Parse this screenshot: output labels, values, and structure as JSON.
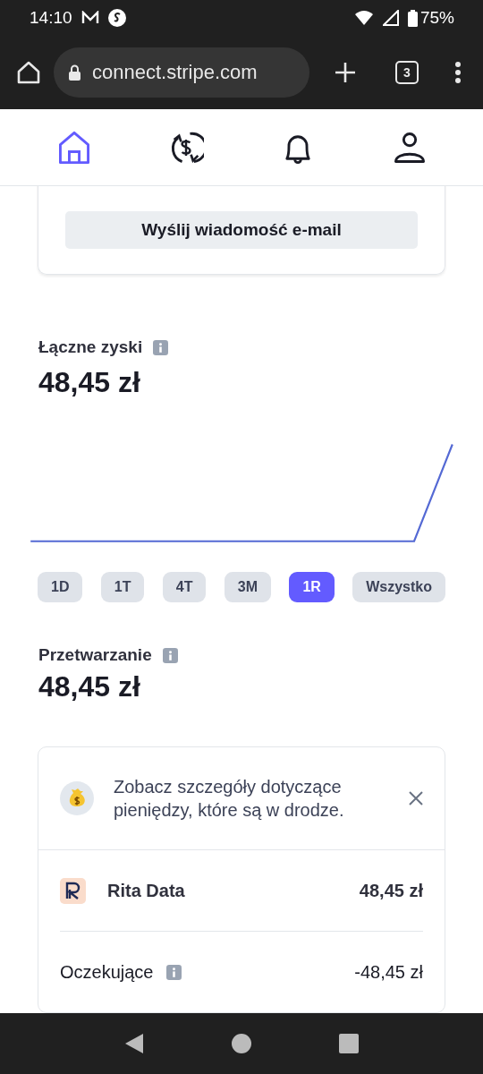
{
  "status_bar": {
    "time": "14:10",
    "battery": "75%"
  },
  "browser": {
    "url": "connect.stripe.com",
    "tab_count": "3"
  },
  "nav": [
    {
      "kind": "home",
      "selected": true
    },
    {
      "kind": "payouts",
      "selected": false
    },
    {
      "kind": "notifications",
      "selected": false
    },
    {
      "kind": "account",
      "selected": false
    }
  ],
  "email_card": {
    "button": "Wyślij wiadomość e-mail"
  },
  "earnings": {
    "label": "Łączne zyski",
    "amount": "48,45 zł"
  },
  "ranges": [
    {
      "label": "1D",
      "selected": false
    },
    {
      "label": "1T",
      "selected": false
    },
    {
      "label": "4T",
      "selected": false
    },
    {
      "label": "3M",
      "selected": false
    },
    {
      "label": "1R",
      "selected": true
    },
    {
      "label": "Wszystko",
      "selected": false
    }
  ],
  "processing": {
    "label": "Przetwarzanie",
    "amount": "48,45 zł"
  },
  "info_card": {
    "message": "Zobacz szczegóły dotyczące pieniędzy, które są w drodze.",
    "merchant": {
      "name": "Rita Data",
      "amount": "48,45 zł"
    },
    "pending": {
      "label": "Oczekujące",
      "amount": "-48,45 zł"
    }
  }
}
